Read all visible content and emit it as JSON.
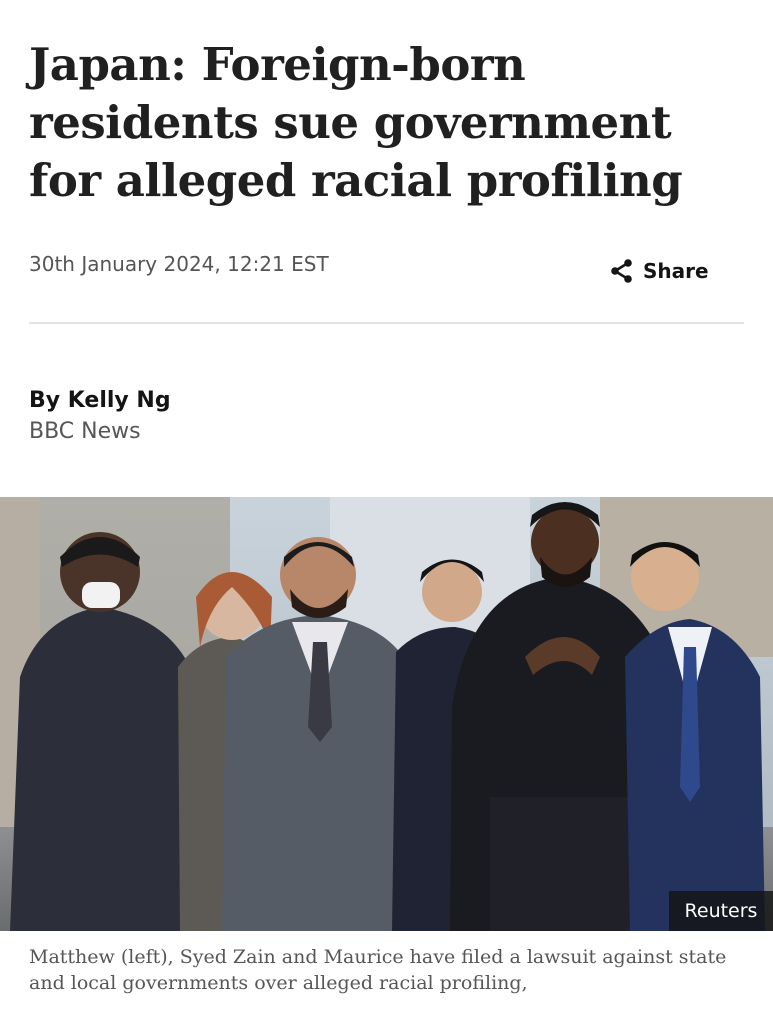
{
  "article": {
    "headline": "Japan: Foreign-born residents sue government for alleged racial profiling",
    "date": "30th January 2024, 12:21 EST",
    "share_label": "Share",
    "byline": {
      "author": "By Kelly Ng",
      "outlet": "BBC News"
    },
    "image": {
      "credit": "Reuters",
      "caption": "Matthew (left), Syed Zain and Maurice have filed a lawsuit against state and local governments over alleged racial profiling,"
    }
  },
  "icons": {
    "share": "share-icon"
  },
  "colors": {
    "headline": "#202020",
    "meta_text": "#555555",
    "divider": "#e2e2e2",
    "credit_bg": "#141414"
  }
}
